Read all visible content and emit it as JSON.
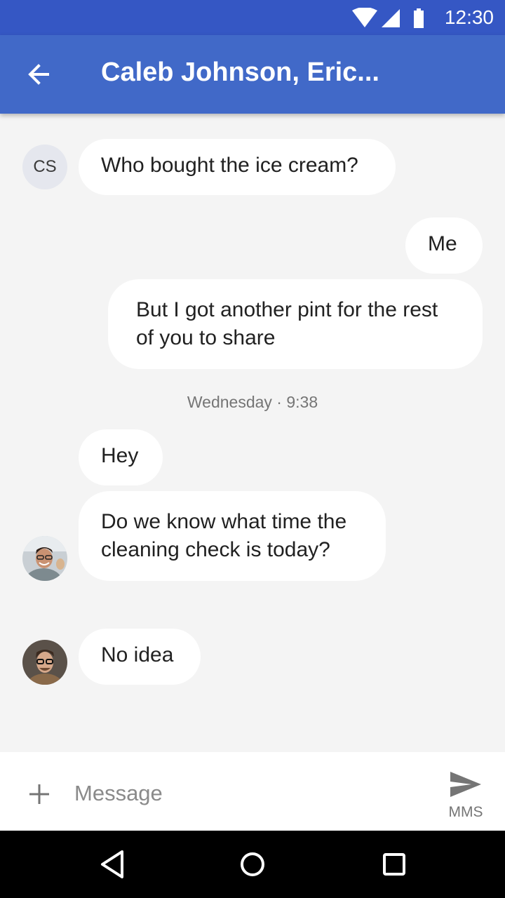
{
  "status_bar": {
    "time": "12:30",
    "icons": [
      "wifi-icon",
      "signal-icon",
      "battery-icon"
    ]
  },
  "app_bar": {
    "back_icon": "arrow-back-icon",
    "title": "Caleb Johnson, Eric..."
  },
  "conversation": {
    "messages": [
      {
        "sender_initials": "CS",
        "text": "Who bought the ice cream?"
      },
      {
        "text": "Me"
      },
      {
        "text_lines": [
          "But I got another pint for the rest",
          "of you to share"
        ]
      },
      {
        "text": "Hey"
      },
      {
        "text_lines": [
          "Do we know what time the",
          "cleaning check is today?"
        ]
      },
      {
        "text": "No idea"
      }
    ],
    "timestamp": "Wednesday · 9:38"
  },
  "composer": {
    "placeholder": "Message",
    "send_label": "MMS"
  },
  "colors": {
    "status_bar": "#3557c4",
    "app_bar": "#4169c8",
    "background": "#f4f4f4",
    "bubble": "#ffffff"
  }
}
